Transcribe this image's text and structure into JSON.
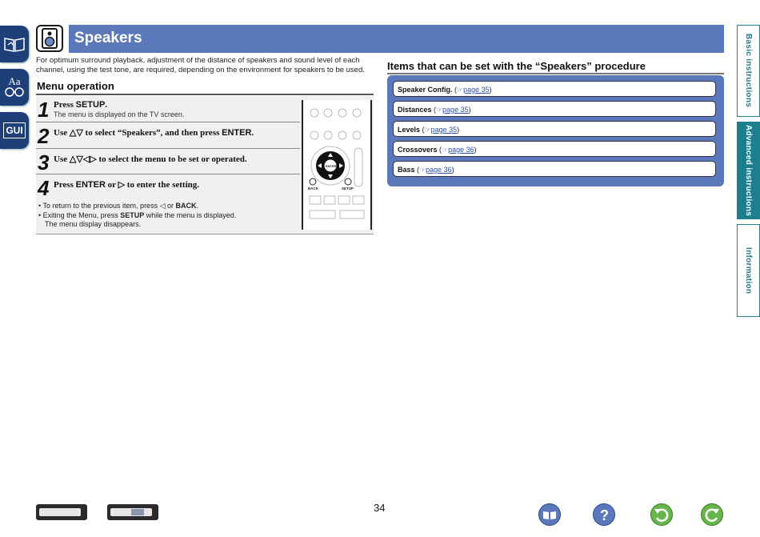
{
  "header": {
    "title": "Speakers",
    "icon": "speaker-icon"
  },
  "intro": "For optimum surround playback, adjustment of the distance of speakers and sound level of each channel, using the test tone, are required, depending on the environment for speakers to be used.",
  "menu_operation": {
    "title": "Menu operation",
    "steps": [
      {
        "num": "1",
        "pre": "Press ",
        "key": "SETUP",
        "post": ".",
        "sub": "The menu is displayed on the TV screen."
      },
      {
        "num": "2",
        "pre": "Use △▽ to select “Speakers”, and then press ",
        "key": "ENTER",
        "post": "."
      },
      {
        "num": "3",
        "pre": "Use △▽◁▷ to select the menu to be set or operated.",
        "key": "",
        "post": ""
      },
      {
        "num": "4",
        "pre": "Press ",
        "key": "ENTER",
        "post": " or ▷ to enter the setting."
      }
    ],
    "notes": {
      "n1_pre": "To return to the previous item, press ◁ or ",
      "n1_key": "BACK",
      "n1_post": ".",
      "n2_pre": "Exiting the Menu, press ",
      "n2_key": "SETUP",
      "n2_post": " while the menu is displayed.",
      "n3": "The menu display disappears."
    },
    "remote_labels": {
      "back": "BACK",
      "setup": "SETUP",
      "enter": "ENTER"
    }
  },
  "items": {
    "title": "Items that can be set with the “Speakers” procedure",
    "list": [
      {
        "name": "Speaker Config.",
        "sep": "  (",
        "link": "page 35",
        "end": ")"
      },
      {
        "name": "Distances",
        "sep": " (",
        "link": "page 35",
        "end": ")"
      },
      {
        "name": "Levels",
        "sep": " (",
        "link": "page 35",
        "end": ")"
      },
      {
        "name": "Crossovers",
        "sep": " (",
        "link": "page 36",
        "end": ")"
      },
      {
        "name": "Bass",
        "sep": " (",
        "link": "page 36",
        "end": ")"
      }
    ]
  },
  "side_tabs": [
    "Basic instructions",
    "Advanced instructions",
    "Information"
  ],
  "left_nav": {
    "contents": "book-icon",
    "glossary": "Aa",
    "gui": "GUI"
  },
  "page_number": "34",
  "colors": {
    "header_bar": "#5b79ba",
    "nav_dark": "#1e3f78",
    "tab_teal": "#1d7f8e",
    "link": "#2b52a3"
  }
}
